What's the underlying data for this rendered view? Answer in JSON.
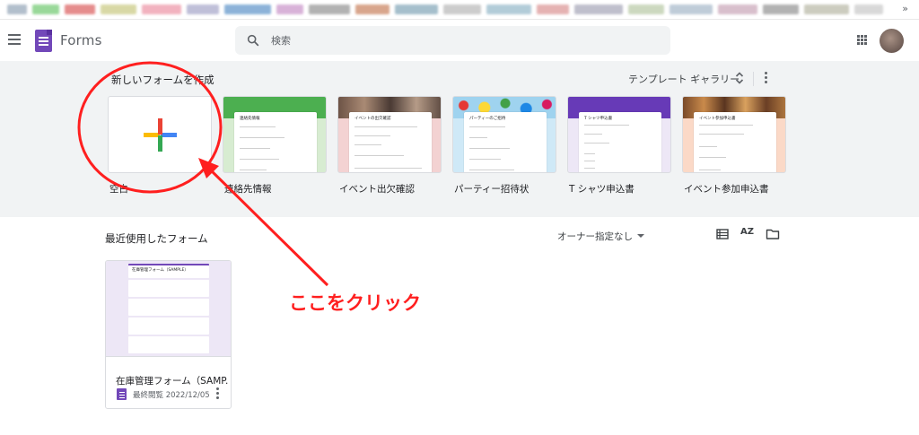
{
  "header": {
    "app_name": "Forms",
    "search_placeholder": "検索"
  },
  "gallery": {
    "title": "新しいフォームを作成",
    "gallery_link": "テンプレート ギャラリー",
    "templates": [
      {
        "label": "空白",
        "card_title": ""
      },
      {
        "label": "連絡先情報",
        "card_title": "連絡先情報"
      },
      {
        "label": "イベント出欠確認",
        "card_title": "イベントの出欠確認"
      },
      {
        "label": "パーティー招待状",
        "card_title": "パーティーのご招待"
      },
      {
        "label": "T シャツ申込書",
        "card_title": "T シャツ申込書"
      },
      {
        "label": "イベント参加申込書",
        "card_title": "イベント参加申込書"
      }
    ]
  },
  "recent": {
    "title": "最近使用したフォーム",
    "owner_filter": "オーナー指定なし",
    "sort_label": "AZ",
    "forms": [
      {
        "name": "在庫管理フォーム（SAMP...",
        "thumb_title": "在庫管理フォーム（SAMPLE）",
        "date": "最終閲覧 2022/12/05"
      }
    ]
  },
  "annotation": {
    "text": "ここをクリック",
    "color": "#ff1f1f"
  },
  "colors": {
    "forms_purple": "#7248b9",
    "gallery_bg": "#f1f3f4"
  }
}
